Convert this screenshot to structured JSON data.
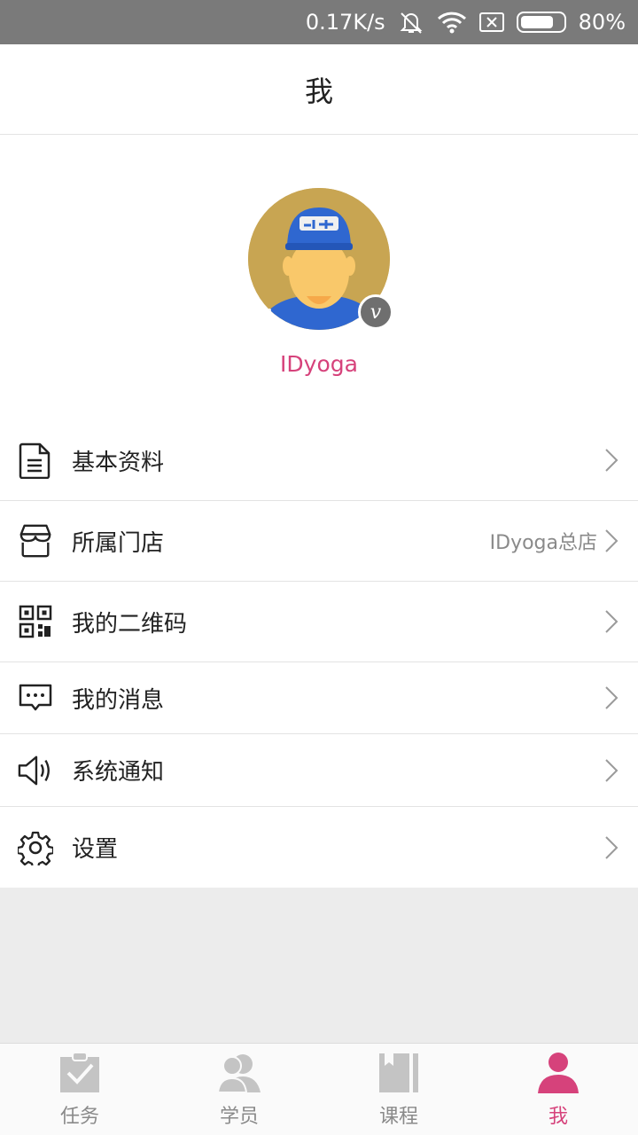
{
  "status_bar": {
    "speed": "0.17K/s",
    "battery": "80%",
    "battery_level": 0.8
  },
  "header": {
    "title": "我"
  },
  "profile": {
    "name": "IDyoga",
    "badge": "v"
  },
  "menu": [
    {
      "label": "基本资料",
      "value": "",
      "icon": "document-icon"
    },
    {
      "label": "所属门店",
      "value": "IDyoga总店",
      "icon": "store-icon"
    },
    {
      "label": "我的二维码",
      "value": "",
      "icon": "qr-code-icon"
    },
    {
      "label": "我的消息",
      "value": "",
      "icon": "message-icon"
    },
    {
      "label": "系统通知",
      "value": "",
      "icon": "speaker-icon"
    },
    {
      "label": "设置",
      "value": "",
      "icon": "gear-icon"
    }
  ],
  "tabs": [
    {
      "label": "任务",
      "icon": "clipboard-check-icon",
      "active": false
    },
    {
      "label": "学员",
      "icon": "people-icon",
      "active": false
    },
    {
      "label": "课程",
      "icon": "book-icon",
      "active": false
    },
    {
      "label": "我",
      "icon": "person-icon",
      "active": true
    }
  ],
  "colors": {
    "accent": "#d6427b",
    "inactive": "#c4c4c4",
    "status_bar": "#7a7a7a"
  }
}
